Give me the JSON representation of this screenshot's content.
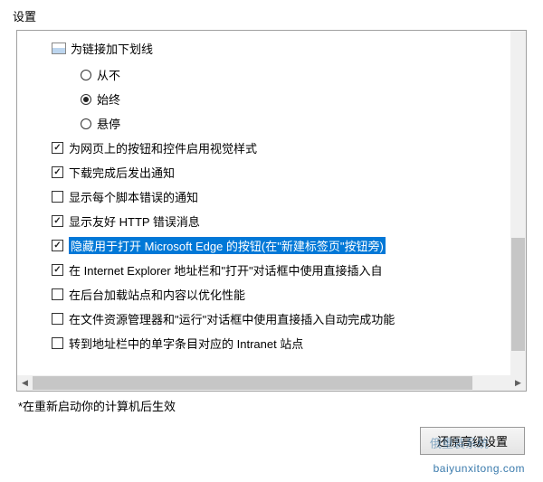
{
  "header": "设置",
  "tree_root": "为链接加下划线",
  "radios": [
    {
      "label": "从不",
      "checked": false
    },
    {
      "label": "始终",
      "checked": true
    },
    {
      "label": "悬停",
      "checked": false
    }
  ],
  "checkboxes": [
    {
      "label": "为网页上的按钮和控件启用视觉样式",
      "checked": true,
      "highlighted": false
    },
    {
      "label": "下载完成后发出通知",
      "checked": true,
      "highlighted": false
    },
    {
      "label": "显示每个脚本错误的通知",
      "checked": false,
      "highlighted": false
    },
    {
      "label": "显示友好 HTTP 错误消息",
      "checked": true,
      "highlighted": false
    },
    {
      "label": "隐藏用于打开 Microsoft Edge 的按钮(在\"新建标签页\"按钮旁)",
      "checked": true,
      "highlighted": true
    },
    {
      "label": "在 Internet Explorer 地址栏和\"打开\"对话框中使用直接插入自",
      "checked": true,
      "highlighted": false
    },
    {
      "label": "在后台加载站点和内容以优化性能",
      "checked": false,
      "highlighted": false
    },
    {
      "label": "在文件资源管理器和\"运行\"对话框中使用直接插入自动完成功能",
      "checked": false,
      "highlighted": false
    },
    {
      "label": "转到地址栏中的单字条目对应的 Intranet 站点",
      "checked": false,
      "highlighted": false
    }
  ],
  "footnote": "*在重新启动你的计算机后生效",
  "buttons": {
    "restore_advanced": "还原高级设置"
  },
  "watermark": {
    "overlay": "俄重装系统",
    "url": "baiyunxitong.com"
  }
}
